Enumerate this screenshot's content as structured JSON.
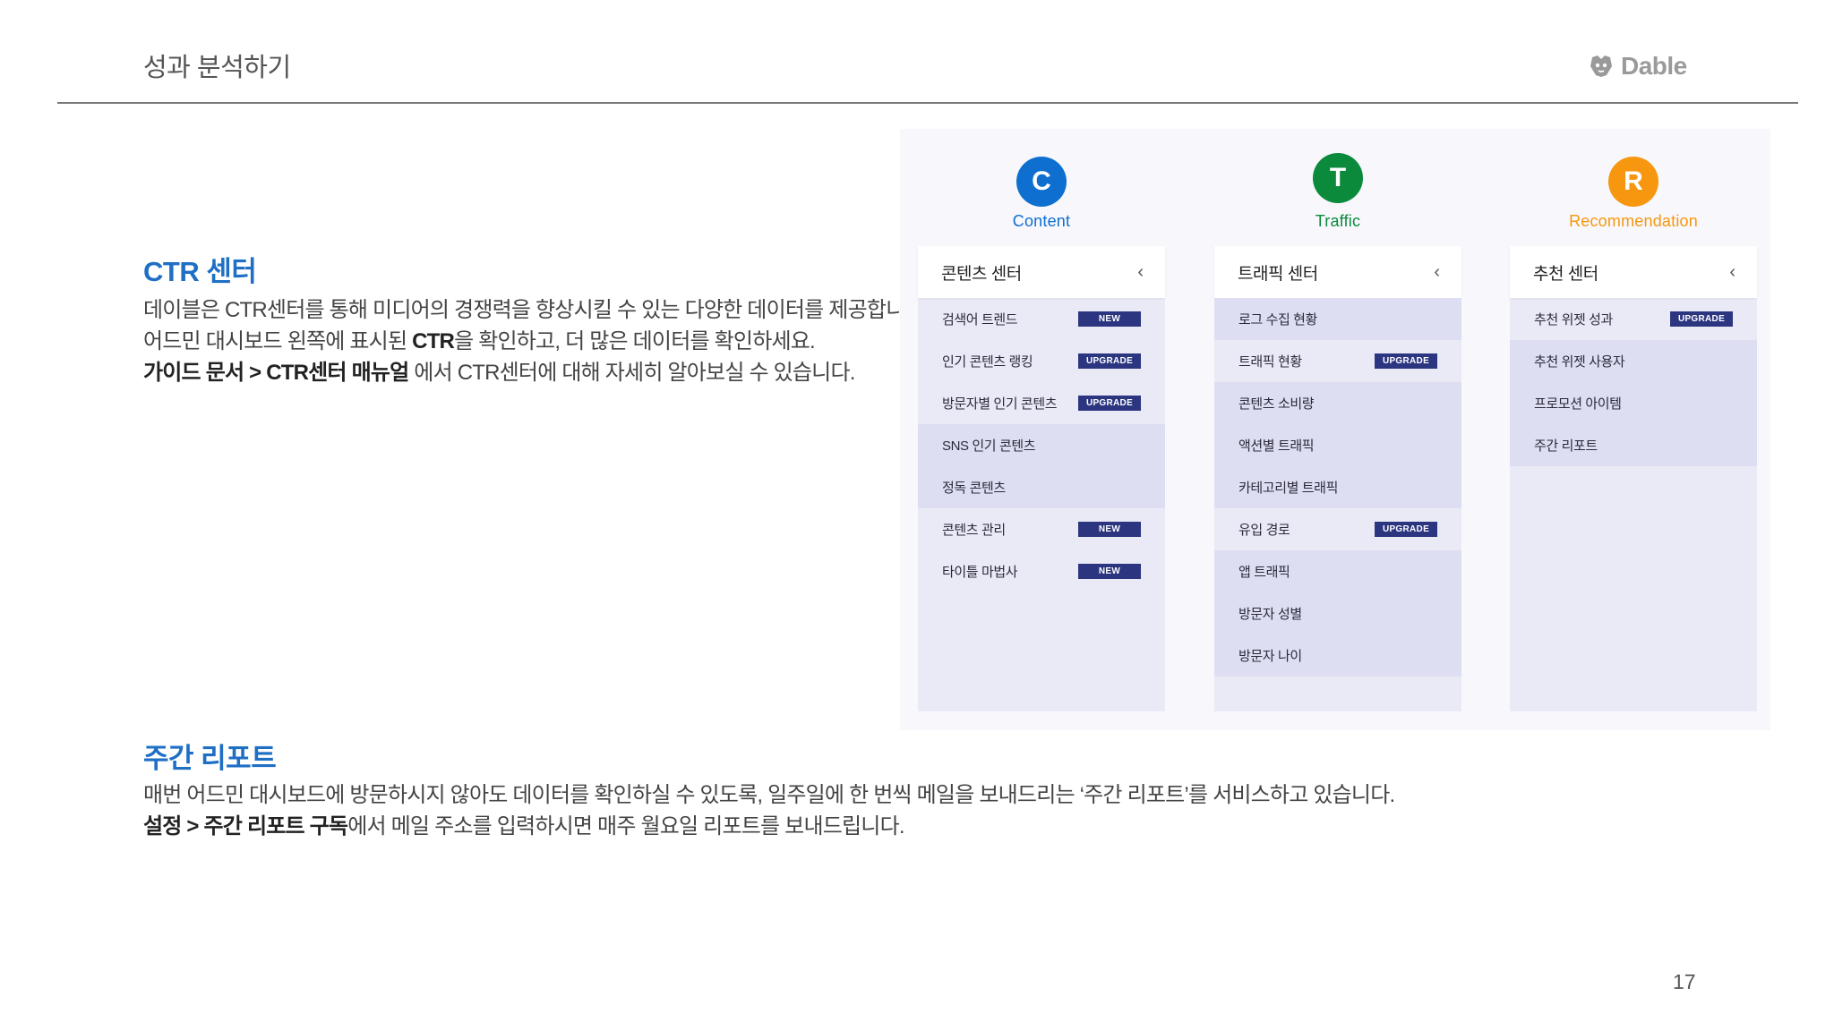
{
  "header": {
    "title": "성과 분석하기",
    "logo_text": "Dable"
  },
  "ctr": {
    "title": "CTR 센터",
    "line1": "데이블은 CTR센터를 통해 미디어의 경쟁력을 향상시킬 수 있는 다양한 데이터를 제공합니다.",
    "line2_pre": "어드민 대시보드 왼쪽에 표시된 ",
    "line2_bold": "CTR",
    "line2_post": "을 확인하고, 더 많은 데이터를 확인하세요.",
    "line3_bold": "가이드 문서 > CTR센터 매뉴얼",
    "line3_post": " 에서 CTR센터에 대해 자세히 알아보실 수 있습니다."
  },
  "weekly": {
    "title": "주간 리포트",
    "line1": "매번 어드민 대시보드에 방문하시지 않아도 데이터를 확인하실 수 있도록, 일주일에 한 번씩 메일을 보내드리는 ‘주간 리포트’를 서비스하고 있습니다.",
    "line2_bold": "설정 > 주간 리포트 구독",
    "line2_post": "에서 메일 주소를 입력하시면 매주 월요일 리포트를 보내드립니다."
  },
  "columns": [
    {
      "letter": "C",
      "label": "Content",
      "color": "#0f6fd0",
      "menu_title": "콘텐츠 센터",
      "chevron": "‹",
      "items": [
        {
          "label": "검색어 트렌드",
          "badge": "NEW"
        },
        {
          "label": "인기 콘텐츠 랭킹",
          "badge": "UPGRADE"
        },
        {
          "label": "방문자별 인기 콘텐츠",
          "badge": "UPGRADE"
        },
        {
          "label": "SNS 인기 콘텐츠",
          "badge": ""
        },
        {
          "label": "정독 콘텐츠",
          "badge": ""
        },
        {
          "label": "콘텐츠 관리",
          "badge": "NEW"
        },
        {
          "label": "타이틀 마법사",
          "badge": "NEW"
        }
      ]
    },
    {
      "letter": "T",
      "label": "Traffic",
      "color": "#0b8a3c",
      "menu_title": "트래픽 센터",
      "chevron": "‹",
      "items": [
        {
          "label": "로그 수집 현황",
          "badge": ""
        },
        {
          "label": "트래픽 현황",
          "badge": "UPGRADE"
        },
        {
          "label": "콘텐츠 소비량",
          "badge": ""
        },
        {
          "label": "액션별 트래픽",
          "badge": ""
        },
        {
          "label": "카테고리별 트래픽",
          "badge": ""
        },
        {
          "label": "유입 경로",
          "badge": "UPGRADE"
        },
        {
          "label": "앱 트래픽",
          "badge": ""
        },
        {
          "label": "방문자 성별",
          "badge": ""
        },
        {
          "label": "방문자 나이",
          "badge": ""
        }
      ]
    },
    {
      "letter": "R",
      "label": "Recommendation",
      "color": "#f7970f",
      "menu_title": "추천 센터",
      "chevron": "‹",
      "items": [
        {
          "label": "추천 위젯 성과",
          "badge": "UPGRADE"
        },
        {
          "label": "추천 위젯 사용자",
          "badge": ""
        },
        {
          "label": "프로모션 아이템",
          "badge": ""
        },
        {
          "label": "주간 리포트",
          "badge": ""
        }
      ]
    }
  ],
  "page_number": "17"
}
